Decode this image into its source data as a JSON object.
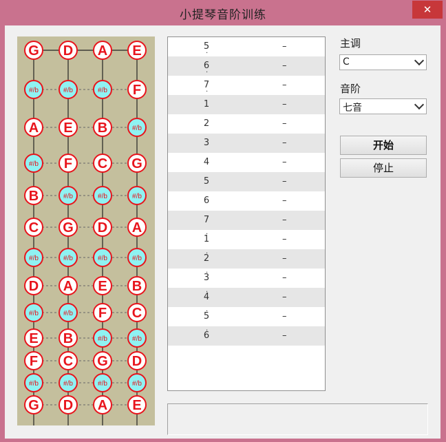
{
  "window": {
    "title": "小提琴音阶训练",
    "close_glyph": "✕"
  },
  "fretboard": {
    "rows": [
      [
        "G",
        "D",
        "A",
        "E"
      ],
      [
        "#/b",
        "#/b",
        "#/b",
        "F"
      ],
      [
        "A",
        "E",
        "B",
        "#/b"
      ],
      [
        "#/b",
        "F",
        "C",
        "G"
      ],
      [
        "B",
        "#/b",
        "#/b",
        "#/b"
      ],
      [
        "C",
        "G",
        "D",
        "A"
      ],
      [
        "#/b",
        "#/b",
        "#/b",
        "#/b"
      ],
      [
        "D",
        "A",
        "E",
        "B"
      ],
      [
        "#/b",
        "#/b",
        "F",
        "C"
      ],
      [
        "E",
        "B",
        "#/b",
        "#/b"
      ],
      [
        "F",
        "C",
        "G",
        "D"
      ],
      [
        "#/b",
        "#/b",
        "#/b",
        "#/b"
      ],
      [
        "G",
        "D",
        "A",
        "E"
      ]
    ],
    "colors": {
      "background": "#c4bf9d",
      "circle_stroke": "#e8141c",
      "natural_fill": "#ffffff",
      "accidental_fill": "#8ff2f2",
      "text": "#e8141c"
    }
  },
  "notes": [
    {
      "num": "5",
      "dot": "below",
      "value": "–"
    },
    {
      "num": "6",
      "dot": "below",
      "value": "–"
    },
    {
      "num": "7",
      "dot": "below",
      "value": "–"
    },
    {
      "num": "1",
      "dot": "",
      "value": "–"
    },
    {
      "num": "2",
      "dot": "",
      "value": "–"
    },
    {
      "num": "3",
      "dot": "",
      "value": "–"
    },
    {
      "num": "4",
      "dot": "",
      "value": "–"
    },
    {
      "num": "5",
      "dot": "",
      "value": "–"
    },
    {
      "num": "6",
      "dot": "",
      "value": "–"
    },
    {
      "num": "7",
      "dot": "",
      "value": "–"
    },
    {
      "num": "1",
      "dot": "above",
      "value": "–"
    },
    {
      "num": "2",
      "dot": "above",
      "value": "–"
    },
    {
      "num": "3",
      "dot": "above",
      "value": "–"
    },
    {
      "num": "4",
      "dot": "above",
      "value": "–"
    },
    {
      "num": "5",
      "dot": "above",
      "value": "–"
    },
    {
      "num": "6",
      "dot": "above",
      "value": "–"
    }
  ],
  "controls": {
    "key_label": "主调",
    "key_value": "C",
    "scale_label": "音阶",
    "scale_value": "七音",
    "start_label": "开始",
    "stop_label": "停止"
  }
}
